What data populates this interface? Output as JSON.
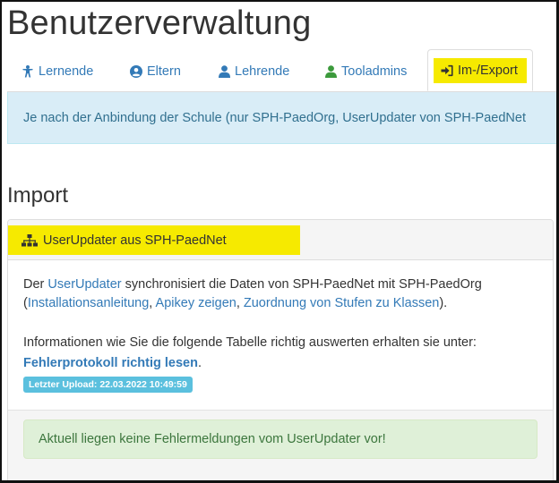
{
  "page": {
    "title": "Benutzerverwaltung"
  },
  "tabs": [
    {
      "label": "Lernende",
      "icon": "child-icon",
      "active": false
    },
    {
      "label": "Eltern",
      "icon": "user-circle-icon",
      "active": false
    },
    {
      "label": "Lehrende",
      "icon": "user-icon",
      "active": false
    },
    {
      "label": "Tooladmins",
      "icon": "user-icon",
      "active": false
    },
    {
      "label": "Im-/Export",
      "icon": "sign-in-icon",
      "active": true
    }
  ],
  "info_alert": {
    "text": "Je nach der Anbindung der Schule (nur SPH-PaedOrg, UserUpdater von SPH-PaedNet"
  },
  "section": {
    "title": "Import"
  },
  "panel": {
    "heading": "UserUpdater aus SPH-PaedNet",
    "body": {
      "line1_prefix": "Der ",
      "line1_link": "UserUpdater",
      "line1_suffix": " synchronisiert die Daten von SPH-PaedNet mit SPH-PaedOrg",
      "line2_open": "(",
      "link_install": "Installationsanleitung",
      "sep1": ", ",
      "link_apikey": "Apikey zeigen",
      "sep2": ", ",
      "link_mapping": "Zuordnung von Stufen zu Klassen",
      "line2_close": ").",
      "line3": "Informationen wie Sie die folgende Tabelle richtig auswerten erhalten sie unter:",
      "link_error_log": "Fehlerprotokoll richtig lesen",
      "line4_suffix": ".",
      "upload_badge": "Letzter Upload: 22.03.2022 10:49:59"
    },
    "success_alert": "Aktuell liegen keine Fehlermeldungen vom UserUpdater vor!"
  },
  "colors": {
    "link": "#337ab7",
    "highlight": "#f6ea00",
    "info_bg": "#d9edf7",
    "success_bg": "#dff0d8",
    "badge": "#5bc0de",
    "tooladmin_icon": "#3c9a3c"
  }
}
